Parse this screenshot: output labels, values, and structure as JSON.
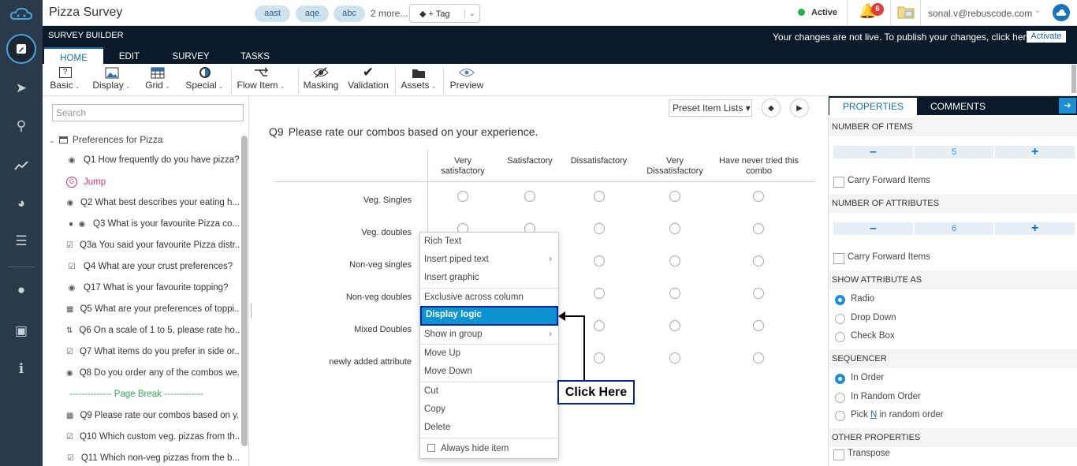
{
  "app": {
    "title": "Pizza Survey",
    "tags": [
      "aast",
      "aqe",
      "abc"
    ],
    "more_tags": "2 more...",
    "add_tag": "+ Tag",
    "status": "Active",
    "notifications": "6",
    "user_email": "sonal.v@rebuscode.com"
  },
  "builder": {
    "title": "SURVEY BUILDER",
    "notice": "Your changes are not live. To publish your changes, click here",
    "activate": "Activate"
  },
  "tabs": [
    "HOME",
    "EDIT",
    "SURVEY",
    "TASKS"
  ],
  "ribbon": {
    "basic": "Basic",
    "display": "Display",
    "grid": "Grid",
    "special": "Special",
    "flow_item": "Flow Item",
    "masking": "Masking",
    "validation": "Validation",
    "assets": "Assets",
    "preview": "Preview"
  },
  "left": {
    "search_placeholder": "Search",
    "group": "Preferences for Pizza",
    "items": [
      "Q1 How frequently do you have pizza?",
      "Jump",
      "Q2 What best describes your eating h...",
      "Q3 What is your favourite Pizza co...",
      "Q3a You said your favourite Pizza distr...",
      "Q4 What are your crust preferences?",
      "Q17 What is your favourite topping?",
      "Q5 What are your preferences of toppi...",
      "Q6 On a scale of 1 to 5, please rate ho...",
      "Q7 What items do you prefer in side or...",
      "Q8 Do you order any of the combos we..."
    ],
    "page_break": "-------------- Page Break -------------",
    "items2": [
      "Q9 Please rate our combos based on y...",
      "Q10 Which custom veg. pizzas from th...",
      "Q11 Which non-veg pizzas from the b..."
    ]
  },
  "center": {
    "preset": "Preset Item Lists ▾",
    "qnum": "Q9",
    "qtext": "Please rate our combos based on your experience.",
    "columns": [
      "Very satisfactory",
      "Satisfactory",
      "Dissatisfactory",
      "Very Dissatisfactory",
      "Have never tried this combo"
    ],
    "rows": [
      "Veg. Singles",
      "Veg. doubles",
      "Non-veg singles",
      "Non-veg doubles",
      "Mixed Doubles",
      "newly added attribute"
    ]
  },
  "context_menu": [
    "Rich Text",
    "Insert piped text",
    "Insert graphic",
    "Exclusive across column",
    "Display logic",
    "Show in group",
    "Move Up",
    "Move Down",
    "Cut",
    "Copy",
    "Delete",
    "Always hide item"
  ],
  "callout": "Click Here",
  "right": {
    "tab_properties": "PROPERTIES",
    "tab_comments": "COMMENTS",
    "num_items": "NUMBER OF ITEMS",
    "num_items_val": "5",
    "carry1": "Carry Forward Items",
    "num_attrs": "NUMBER OF ATTRIBUTES",
    "num_attrs_val": "6",
    "carry2": "Carry Forward Items",
    "show_as": "SHOW ATTRIBUTE AS",
    "radio": "Radio",
    "dropdown": "Drop Down",
    "checkbox": "Check Box",
    "sequencer": "SEQUENCER",
    "in_order": "In Order",
    "random": "In Random Order",
    "pick_a": "Pick",
    "pick_n": "N",
    "pick_b": "in random order",
    "other": "OTHER PROPERTIES",
    "transpose": "Transpose"
  }
}
